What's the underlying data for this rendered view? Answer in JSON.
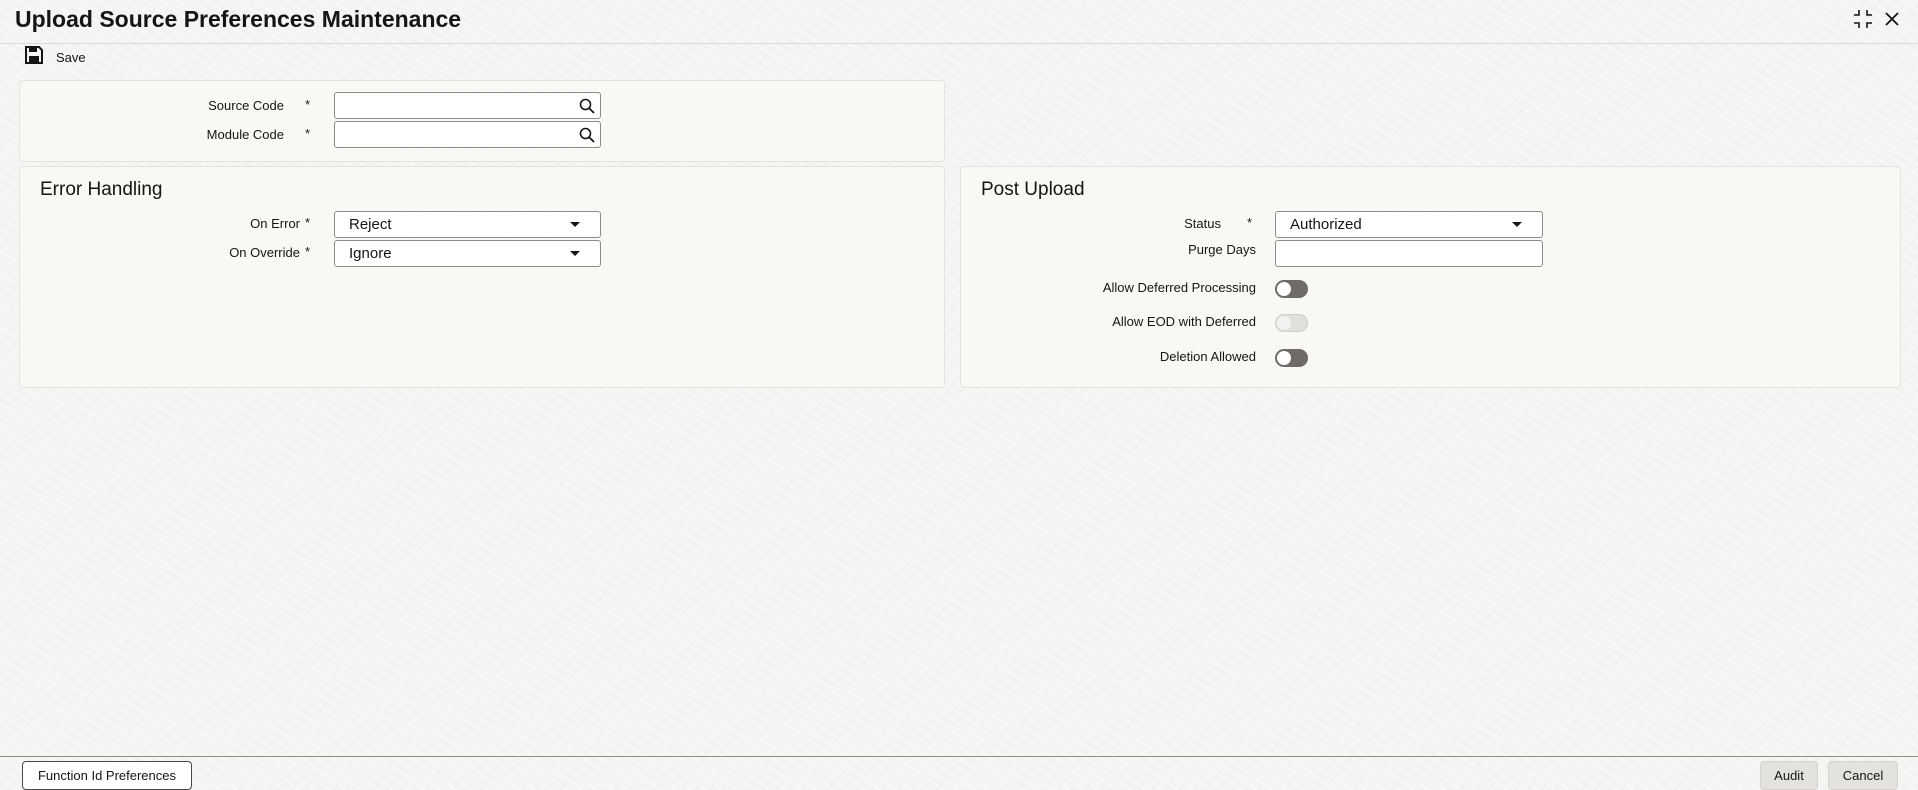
{
  "window": {
    "title": "Upload Source Preferences Maintenance",
    "icons": {
      "maximize": "maximize-icon",
      "close": "close-icon"
    }
  },
  "toolbar": {
    "save_label": "Save",
    "save_icon": "floppy-disk-icon"
  },
  "header_form": {
    "source_code": {
      "label": "Source Code",
      "required": "*",
      "value": ""
    },
    "module_code": {
      "label": "Module Code",
      "required": "*",
      "value": ""
    }
  },
  "error_handling": {
    "title": "Error Handling",
    "on_error": {
      "label": "On Error",
      "required": "*",
      "value": "Reject"
    },
    "on_override": {
      "label": "On Override",
      "required": "*",
      "value": "Ignore"
    }
  },
  "post_upload": {
    "title": "Post Upload",
    "status": {
      "label": "Status",
      "required": "*",
      "value": "Authorized"
    },
    "purge_days": {
      "label": "Purge Days",
      "value": ""
    },
    "allow_deferred_processing": {
      "label": "Allow Deferred Processing",
      "checked": false
    },
    "allow_eod_with_deferred": {
      "label": "Allow EOD with Deferred",
      "checked": false,
      "disabled": true
    },
    "deletion_allowed": {
      "label": "Deletion Allowed",
      "checked": false
    }
  },
  "footer": {
    "function_id_preferences": "Function Id Preferences",
    "audit": "Audit",
    "cancel": "Cancel"
  }
}
